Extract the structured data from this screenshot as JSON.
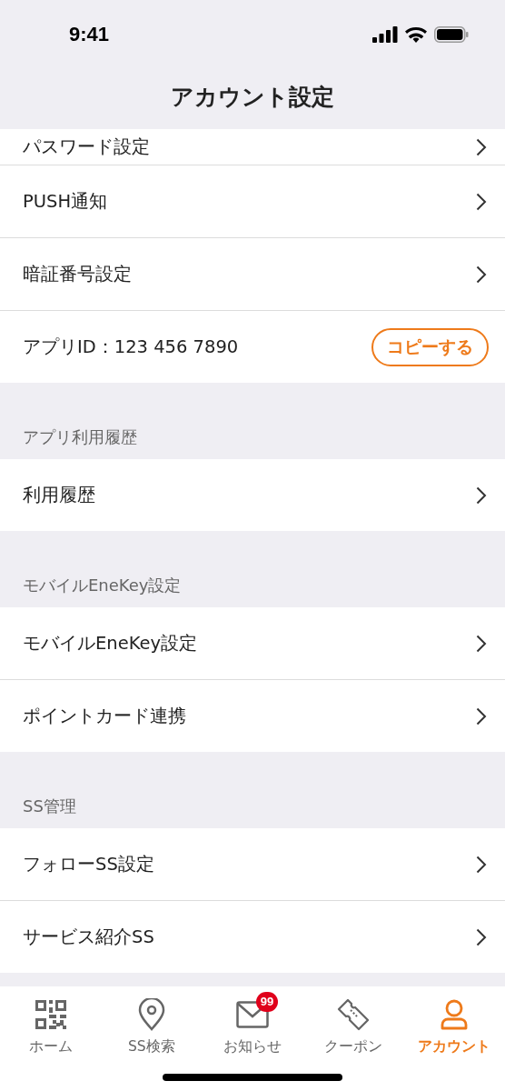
{
  "status_bar": {
    "time": "9:41"
  },
  "header": {
    "title": "アカウント設定"
  },
  "sections": [
    {
      "items": [
        {
          "kind": "link",
          "label": "パスワード設定"
        },
        {
          "kind": "link",
          "label": "PUSH通知"
        },
        {
          "kind": "link",
          "label": "暗証番号設定"
        },
        {
          "kind": "copy",
          "label": "アプリID：123 456 7890",
          "button": "コピーする"
        }
      ]
    },
    {
      "title": "アプリ利用履歴",
      "items": [
        {
          "kind": "link",
          "label": "利用履歴"
        }
      ]
    },
    {
      "title": "モバイルEneKey設定",
      "items": [
        {
          "kind": "link",
          "label": "モバイルEneKey設定"
        },
        {
          "kind": "link",
          "label": "ポイントカード連携"
        }
      ]
    },
    {
      "title": "SS管理",
      "items": [
        {
          "kind": "link",
          "label": "フォローSS設定"
        },
        {
          "kind": "link",
          "label": "サービス紹介SS"
        }
      ]
    }
  ],
  "tab_bar": [
    {
      "label": "ホーム",
      "selected": false
    },
    {
      "label": "SS検索",
      "selected": false
    },
    {
      "label": "お知らせ",
      "selected": false,
      "badge": "99"
    },
    {
      "label": "クーポン",
      "selected": false
    },
    {
      "label": "アカウント",
      "selected": true
    }
  ]
}
